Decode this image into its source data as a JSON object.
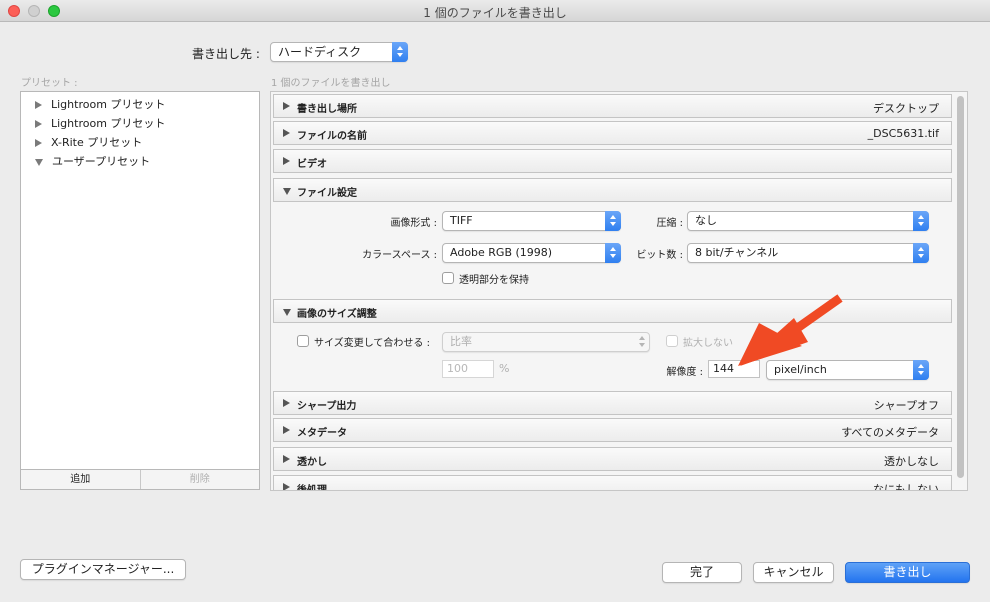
{
  "window": {
    "title": "1 個のファイルを書き出し"
  },
  "destination": {
    "label": "書き出し先 :",
    "value": "ハードディスク"
  },
  "presets": {
    "header": "プリセット :",
    "items": [
      {
        "label": "Lightroom プリセット",
        "expanded": false
      },
      {
        "label": "Lightroom プリセット",
        "expanded": false
      },
      {
        "label": "X-Rite プリセット",
        "expanded": false
      },
      {
        "label": "ユーザープリセット",
        "expanded": true
      }
    ],
    "add_label": "追加",
    "remove_label": "削除"
  },
  "main": {
    "subtitle": "1 個のファイルを書き出し",
    "sections": {
      "export_location": {
        "label": "書き出し場所",
        "value": "デスクトップ"
      },
      "file_naming": {
        "label": "ファイルの名前",
        "value": "_DSC5631.tif"
      },
      "video": {
        "label": "ビデオ",
        "value": ""
      },
      "file_settings": {
        "label": "ファイル設定",
        "format_label": "画像形式 :",
        "format_value": "TIFF",
        "compression_label": "圧縮 :",
        "compression_value": "なし",
        "colorspace_label": "カラースペース :",
        "colorspace_value": "Adobe RGB (1998)",
        "bitdepth_label": "ビット数 :",
        "bitdepth_value": "8 bit/チャンネル",
        "transparency_label": "透明部分を保持"
      },
      "image_sizing": {
        "label": "画像のサイズ調整",
        "resize_label": "サイズ変更して合わせる :",
        "resize_mode": "比率",
        "no_enlarge_label": "拡大しない",
        "percent_value": "100",
        "percent_unit": "%",
        "resolution_label": "解像度 :",
        "resolution_value": "144",
        "resolution_unit": "pixel/inch"
      },
      "output_sharpening": {
        "label": "シャープ出力",
        "value": "シャープオフ"
      },
      "metadata": {
        "label": "メタデータ",
        "value": "すべてのメタデータ"
      },
      "watermarking": {
        "label": "透かし",
        "value": "透かしなし"
      },
      "post_processing": {
        "label": "後処理",
        "value": "なにもしない"
      }
    }
  },
  "footer": {
    "plugin_manager": "プラグインマネージャー...",
    "done": "完了",
    "cancel": "キャンセル",
    "export": "書き出し"
  },
  "colors": {
    "accent": "#2f7ff0",
    "annotation_arrow": "#f04a24"
  },
  "icons": {
    "disclosure": "triangle-icon",
    "popup": "updown-chevron-icon"
  }
}
